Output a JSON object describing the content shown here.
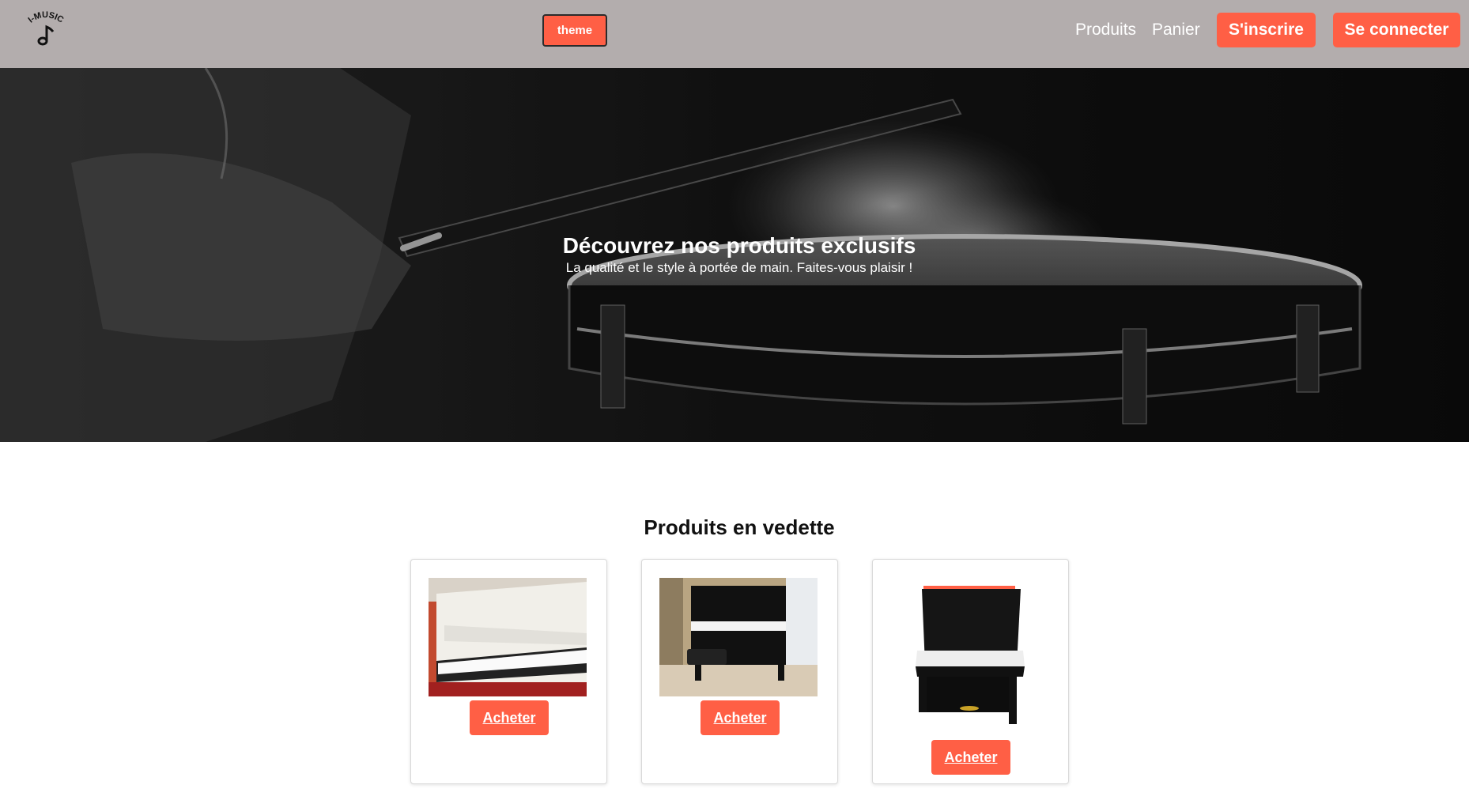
{
  "header": {
    "logo_text": "I-MUSIC",
    "theme_label": "theme",
    "nav": {
      "products": "Produits",
      "cart": "Panier",
      "signup": "S'inscrire",
      "login": "Se connecter"
    }
  },
  "hero": {
    "title": "Découvrez nos produits exclusifs",
    "subtitle": "La qualité et le style à portée de main. Faites-vous plaisir !"
  },
  "featured": {
    "title": "Produits en vedette",
    "products": [
      {
        "buy_label": "Acheter"
      },
      {
        "buy_label": "Acheter"
      },
      {
        "buy_label": "Acheter"
      }
    ]
  },
  "colors": {
    "header_bg": "#b3adad",
    "accent": "#ff5f45"
  },
  "icons": [
    "music-note-icon"
  ]
}
